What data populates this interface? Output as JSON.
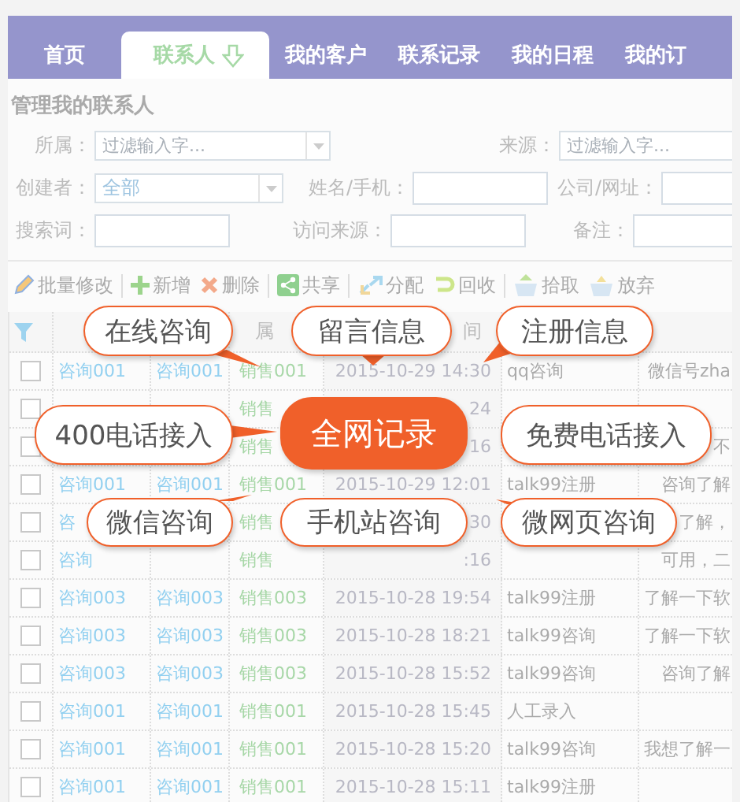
{
  "nav_tabs": [
    {
      "label": "首页",
      "selected": false
    },
    {
      "label": "联系人",
      "selected": true
    },
    {
      "label": "我的客户",
      "selected": false
    },
    {
      "label": "联系记录",
      "selected": false
    },
    {
      "label": "我的日程",
      "selected": false
    },
    {
      "label": "我的订",
      "selected": false
    }
  ],
  "page_title": "管理我的联系人",
  "filter_rows": [
    [
      {
        "label": "所属：",
        "kind": "select",
        "placeholder": "过滤输入字..."
      },
      {
        "label": "来源：",
        "kind": "select",
        "placeholder": "过滤输入字..."
      }
    ],
    [
      {
        "label": "创建者：",
        "kind": "select",
        "value": "全部"
      },
      {
        "label": "姓名/手机：",
        "kind": "input"
      },
      {
        "label": "公司/网址：",
        "kind": "input"
      }
    ],
    [
      {
        "label": "搜索词：",
        "kind": "input"
      },
      {
        "label": "访问来源：",
        "kind": "input"
      },
      {
        "label": "备注：",
        "kind": "input"
      }
    ]
  ],
  "toolbar_groups": [
    [
      "批量修改"
    ],
    [
      "新增",
      "删除"
    ],
    [
      "共享"
    ],
    [
      "分配",
      "回收"
    ],
    [
      "拾取",
      "放弃"
    ]
  ],
  "table": {
    "header": {
      "column_4": "属",
      "column_5": "间"
    },
    "rows": [
      {
        "checked": false,
        "column_2": "咨询001",
        "column_3": "咨询001",
        "column_4": "销售001",
        "column_5": "2015-10-29 14:30",
        "column_6": "qq咨询",
        "column_7": "微信号zha"
      },
      {
        "checked": false,
        "column_4": "销售",
        "column_5": "24"
      },
      {
        "checked": false,
        "column_4": "销售",
        "column_5": "16",
        "column_7": "不"
      },
      {
        "checked": false,
        "column_2": "咨询001",
        "column_3": "咨询001",
        "column_4": "销售001",
        "column_5": "2015-10-29 12:01",
        "column_6": "talk99注册",
        "column_7": "咨询了解"
      },
      {
        "checked": false,
        "column_2": "咨",
        "column_4": "销售",
        "column_5": "30",
        "column_7": "了解，"
      },
      {
        "checked": false,
        "column_2": "咨询",
        "column_4": "销售",
        "column_5": ":16",
        "column_7": "可用，二"
      },
      {
        "checked": false,
        "column_2": "咨询003",
        "column_3": "咨询003",
        "column_4": "销售003",
        "column_5": "2015-10-28 19:54",
        "column_6": "talk99注册",
        "column_7": "了解一下软"
      },
      {
        "checked": false,
        "column_2": "咨询003",
        "column_3": "咨询003",
        "column_4": "销售003",
        "column_5": "2015-10-28 18:21",
        "column_6": "talk99咨询",
        "column_7": "了解一下软"
      },
      {
        "checked": false,
        "column_2": "咨询003",
        "column_3": "咨询003",
        "column_4": "销售003",
        "column_5": "2015-10-28 15:52",
        "column_6": "talk99咨询",
        "column_7": "咨询了解"
      },
      {
        "checked": false,
        "column_2": "咨询001",
        "column_3": "咨询001",
        "column_4": "销售001",
        "column_5": "2015-10-28 15:45",
        "column_6": "人工录入"
      },
      {
        "checked": false,
        "column_2": "咨询001",
        "column_3": "咨询001",
        "column_4": "销售001",
        "column_5": "2015-10-28 15:20",
        "column_6": "talk99咨询",
        "column_7": "我想了解一"
      },
      {
        "checked": false,
        "column_2": "咨询001",
        "column_3": "咨询001",
        "column_4": "销售001",
        "column_5": "2015-10-28 15:11",
        "column_6": "talk99注册"
      }
    ]
  },
  "callouts": [
    {
      "text": "在线咨询",
      "kind": "outline"
    },
    {
      "text": "留言信息",
      "kind": "outline"
    },
    {
      "text": "注册信息",
      "kind": "outline"
    },
    {
      "text": "400电话接入",
      "kind": "outline"
    },
    {
      "text": "全网记录",
      "kind": "main"
    },
    {
      "text": "免费电话接入",
      "kind": "outline"
    },
    {
      "text": "微信咨询",
      "kind": "outline"
    },
    {
      "text": "手机站咨询",
      "kind": "outline"
    },
    {
      "text": "微网页咨询",
      "kind": "outline"
    }
  ]
}
